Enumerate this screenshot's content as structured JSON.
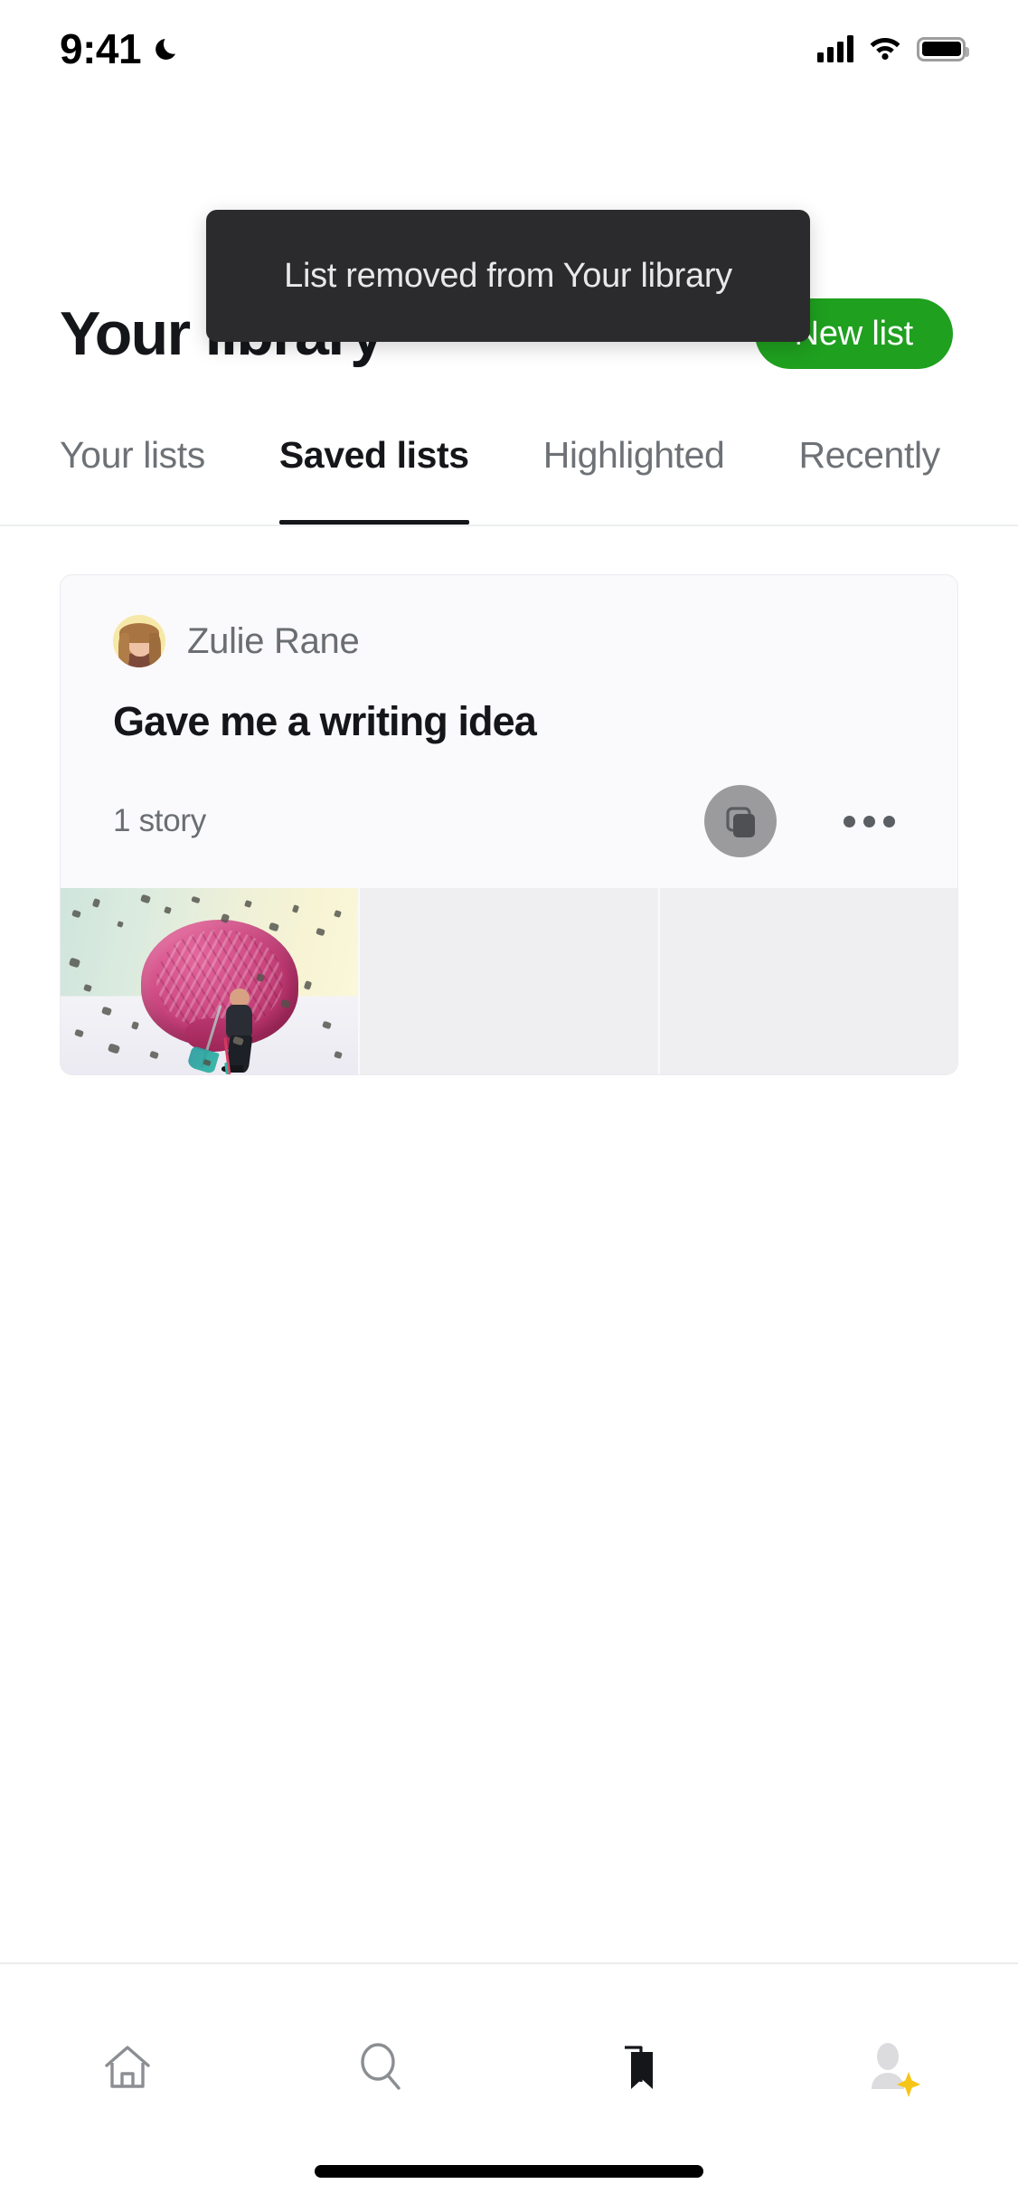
{
  "status_bar": {
    "time": "9:41",
    "dnd_icon": "moon-icon",
    "signal_icon": "cellular-signal-icon",
    "wifi_icon": "wifi-icon",
    "battery_icon": "battery-full-icon"
  },
  "header": {
    "title": "Your library",
    "new_list_label": "New list",
    "accent_color": "#1fa01f"
  },
  "tabs": [
    {
      "label": "Your lists",
      "active": false
    },
    {
      "label": "Saved lists",
      "active": true
    },
    {
      "label": "Highlighted",
      "active": false
    },
    {
      "label": "Recently",
      "active": false
    }
  ],
  "toast": {
    "message": "List removed from Your library",
    "background": "#2b2b2d",
    "text_color": "#e8e8e9"
  },
  "list_card": {
    "author": "Zulie Rane",
    "avatar": "user-avatar",
    "title": "Gave me a writing idea",
    "story_count": "1 story",
    "collection_icon": "stacked-cards-icon",
    "more_icon": "more-horizontal-icon",
    "thumbnails": [
      {
        "type": "image",
        "alt": "pink brain with figure sweeping debris"
      },
      {
        "type": "empty"
      },
      {
        "type": "empty"
      }
    ]
  },
  "bottom_nav": [
    {
      "name": "home",
      "icon": "home-icon",
      "active": false
    },
    {
      "name": "search",
      "icon": "search-icon",
      "active": false
    },
    {
      "name": "library",
      "icon": "bookmark-icon",
      "active": true
    },
    {
      "name": "profile",
      "icon": "profile-avatar-icon",
      "active": false,
      "badge": "sparkle-icon",
      "badge_color": "#f5c518"
    }
  ]
}
